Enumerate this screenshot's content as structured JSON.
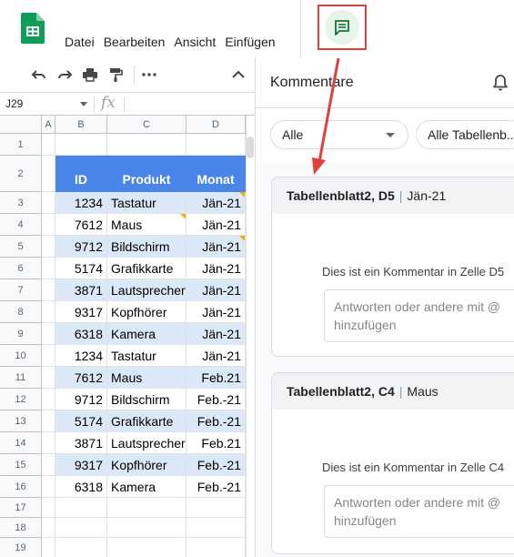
{
  "menu": {
    "items": [
      "Datei",
      "Bearbeiten",
      "Ansicht",
      "Einfügen"
    ]
  },
  "toolbar": {
    "icons": [
      "undo-icon",
      "redo-icon",
      "print-icon",
      "paint-format-icon",
      "more-icon",
      "collapse-icon"
    ]
  },
  "formula_bar": {
    "name_box": "J29",
    "fx_label": "fx"
  },
  "grid": {
    "columns": [
      "A",
      "B",
      "C",
      "D"
    ],
    "rows": [
      "1",
      "2",
      "3",
      "4",
      "5",
      "6",
      "7",
      "8",
      "9",
      "10",
      "11",
      "12",
      "13",
      "14",
      "15",
      "16",
      "17",
      "18",
      "19"
    ],
    "header": {
      "id": "ID",
      "product": "Produkt",
      "month": "Monat"
    },
    "data": [
      {
        "id": "1234",
        "product": "Tastatur",
        "month": "Jän-21",
        "note": true
      },
      {
        "id": "7612",
        "product": "Maus",
        "month": "Jän-21",
        "product_note": true
      },
      {
        "id": "9712",
        "product": "Bildschirm",
        "month": "Jän-21",
        "note": true
      },
      {
        "id": "5174",
        "product": "Grafikkarte",
        "month": "Jän-21"
      },
      {
        "id": "3871",
        "product": "Lautsprecher",
        "month": "Jän-21"
      },
      {
        "id": "9317",
        "product": "Kopfhörer",
        "month": "Jän-21"
      },
      {
        "id": "6318",
        "product": "Kamera",
        "month": "Jän-21"
      },
      {
        "id": "1234",
        "product": "Tastatur",
        "month": "Jän-21"
      },
      {
        "id": "7612",
        "product": "Maus",
        "month": "Feb.21"
      },
      {
        "id": "9712",
        "product": "Bildschirm",
        "month": "Feb.-21"
      },
      {
        "id": "5174",
        "product": "Grafikkarte",
        "month": "Feb.-21"
      },
      {
        "id": "3871",
        "product": "Lautsprecher",
        "month": "Feb.21"
      },
      {
        "id": "9317",
        "product": "Kopfhörer",
        "month": "Feb.-21"
      },
      {
        "id": "6318",
        "product": "Kamera",
        "month": "Feb.-21"
      }
    ]
  },
  "panel": {
    "title": "Kommentare",
    "filter_all": "Alle",
    "filter_sheets": "Alle Tabellenb...",
    "comments": [
      {
        "sheet_ref": "Tabellenblatt2, D5",
        "context": "Jän-21",
        "text": "Dies ist ein Kommentar in Zelle D5",
        "reply_placeholder": "Antworten oder andere mit @ hinzufügen"
      },
      {
        "sheet_ref": "Tabellenblatt2, C4",
        "context": "Maus",
        "text": "Dies ist ein Kommentar in Zelle C4",
        "reply_placeholder": "Antworten oder andere mit @ hinzufügen"
      }
    ]
  },
  "colors": {
    "header_blue": "#4a86e8",
    "band_blue": "#dbe8f7",
    "highlight_red": "#e0403d",
    "sheets_green": "#0f9d58",
    "note_yellow": "#f9ab00"
  }
}
